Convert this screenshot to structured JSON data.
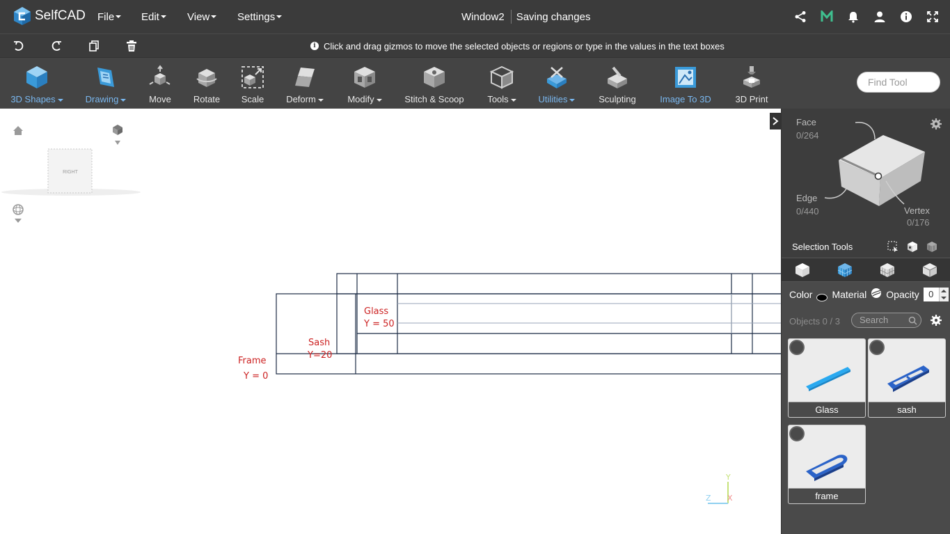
{
  "app": {
    "logo_text": "SelfCAD",
    "menus": [
      {
        "label": "File"
      },
      {
        "label": "Edit"
      },
      {
        "label": "View"
      },
      {
        "label": "Settings"
      }
    ],
    "window_title": "Window2",
    "save_status": "Saving changes",
    "top_icons": [
      "share-icon",
      "m-logo-icon",
      "bell-icon",
      "user-icon",
      "info-icon",
      "fullscreen-icon"
    ]
  },
  "bar2": {
    "icons": [
      "undo-icon",
      "redo-icon",
      "copy-icon",
      "delete-icon"
    ],
    "hint": "Click and drag gizmos to move the selected objects or regions or type in the values in the text boxes"
  },
  "toolbar": {
    "tools": [
      {
        "label": "3D Shapes",
        "dropdown": true,
        "highlight": true
      },
      {
        "label": "Drawing",
        "dropdown": true,
        "highlight": true
      },
      {
        "label": "Move",
        "dropdown": false,
        "highlight": false
      },
      {
        "label": "Rotate",
        "dropdown": false,
        "highlight": false
      },
      {
        "label": "Scale",
        "dropdown": false,
        "highlight": false
      },
      {
        "label": "Deform",
        "dropdown": true,
        "highlight": false
      },
      {
        "label": "Modify",
        "dropdown": true,
        "highlight": false
      },
      {
        "label": "Stitch & Scoop",
        "dropdown": false,
        "highlight": false
      },
      {
        "label": "Tools",
        "dropdown": true,
        "highlight": false
      },
      {
        "label": "Utilities",
        "dropdown": true,
        "highlight": true
      },
      {
        "label": "Sculpting",
        "dropdown": false,
        "highlight": false
      },
      {
        "label": "Image To 3D",
        "dropdown": false,
        "highlight": true
      },
      {
        "label": "3D Print",
        "dropdown": false,
        "highlight": false
      }
    ],
    "find_placeholder": "Find Tool"
  },
  "viewport": {
    "view_cube_label": "RIGHT",
    "annotations": {
      "glass_name": "Glass",
      "glass_y": "Y = 50",
      "sash_name": "Sash",
      "sash_y": "Y=20",
      "frame_name": "Frame",
      "frame_y": "Y = 0"
    },
    "axis_labels": {
      "y": "Y",
      "z": "Z",
      "x": "X"
    },
    "annotation_color": "#cc2222",
    "outline_color": "#1b2a44"
  },
  "selection": {
    "face_label": "Face",
    "face_count": "0/264",
    "edge_label": "Edge",
    "edge_count": "0/440",
    "vertex_label": "Vertex",
    "vertex_count": "0/176",
    "tools_label": "Selection Tools"
  },
  "properties": {
    "color_label": "Color",
    "material_label": "Material",
    "opacity_label": "Opacity",
    "opacity_value": "0"
  },
  "objects": {
    "count_label": "Objects 0 / 3",
    "search_placeholder": "Search",
    "items": [
      {
        "name": "Glass"
      },
      {
        "name": "sash"
      },
      {
        "name": "frame"
      }
    ]
  }
}
